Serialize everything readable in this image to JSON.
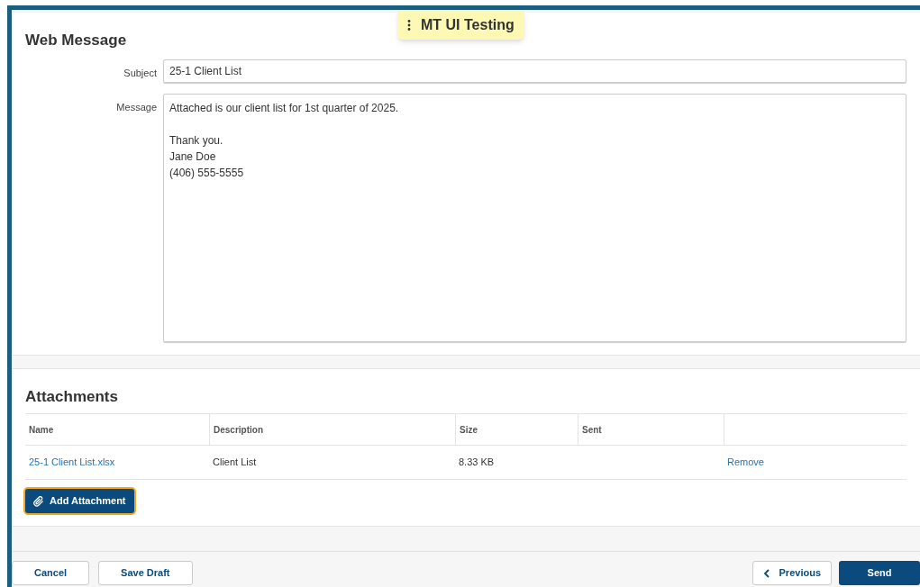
{
  "banner": {
    "label": "MT UI Testing"
  },
  "form": {
    "title": "Web Message",
    "fields": [
      {
        "label": "Subject",
        "value": "25-1 Client List",
        "kind": "input"
      },
      {
        "label": "Message",
        "value": "Attached is our client list for 1st quarter of 2025.\n\nThank you.\nJane Doe\n(406) 555-5555",
        "kind": "textarea"
      }
    ]
  },
  "attachments": {
    "title": "Attachments",
    "columns": [
      "Name",
      "Description",
      "Size",
      "Sent",
      ""
    ],
    "rows": [
      {
        "name": "25-1 Client List.xlsx",
        "description": "Client List",
        "size": "8.33 KB",
        "action": "Remove"
      }
    ],
    "add_button": "Add Attachment"
  },
  "footer": {
    "left": [
      "Cancel",
      "Save Draft"
    ],
    "previous": "Previous",
    "send": "Send"
  }
}
